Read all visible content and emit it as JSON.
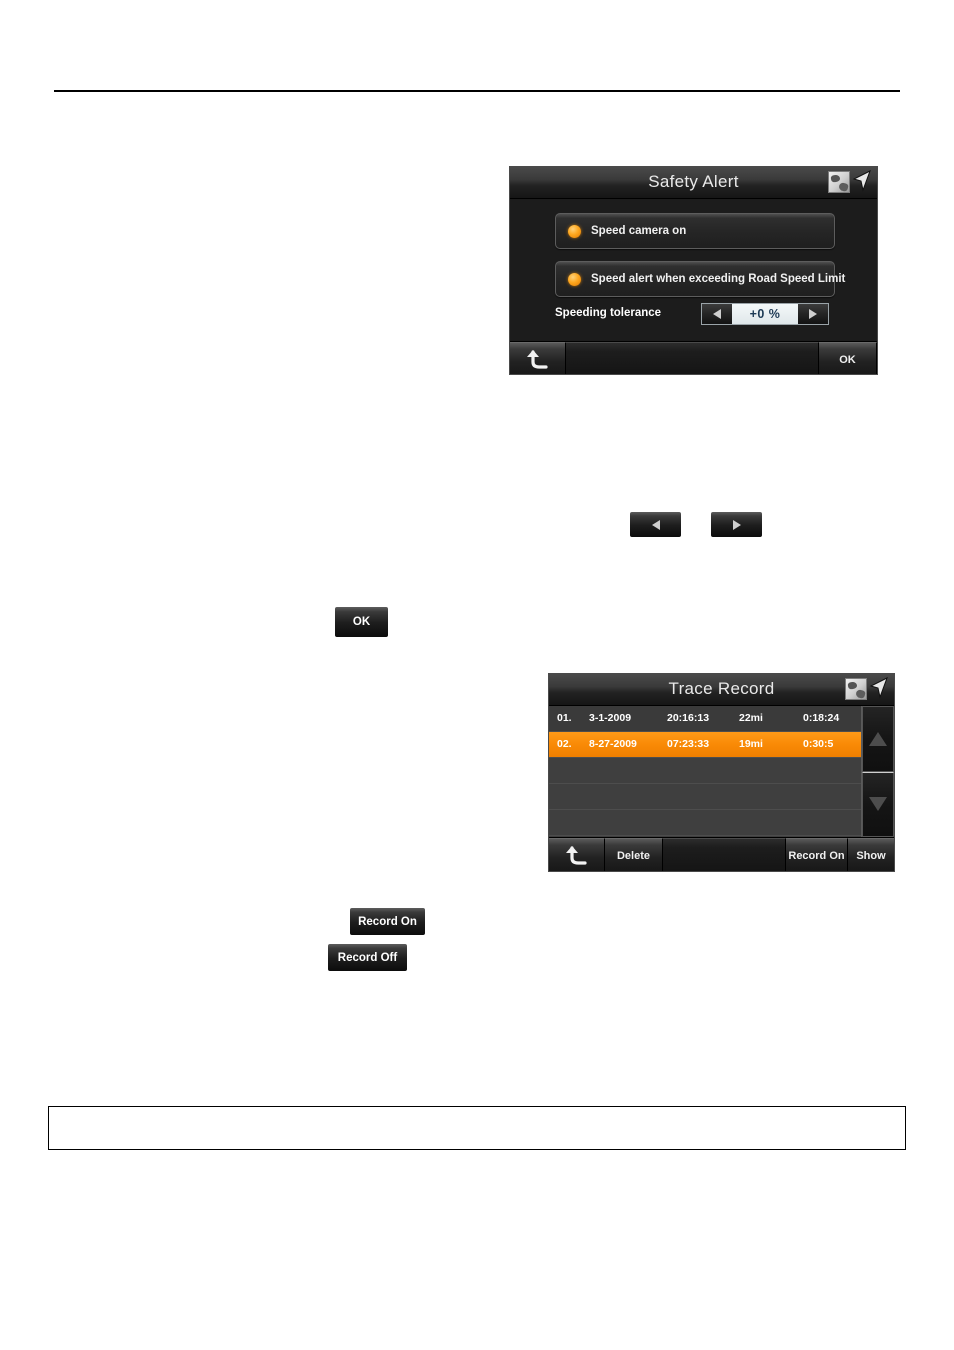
{
  "page": {
    "note_box_text": ""
  },
  "safety_alert": {
    "title": "Safety Alert",
    "corner_icon": "map-cursor-icon",
    "options": [
      {
        "label": "Speed camera on",
        "state_icon": "radio-on-icon"
      },
      {
        "label": "Speed alert when exceeding Road Speed Limit",
        "state_icon": "radio-on-icon"
      }
    ],
    "tolerance": {
      "label": "Speeding tolerance",
      "value": "+0 %",
      "dec_icon": "triangle-left-icon",
      "inc_icon": "triangle-right-icon"
    },
    "toolbar": {
      "back_icon": "back-arrow-icon",
      "ok_label": "OK"
    }
  },
  "trace_record": {
    "title": "Trace Record",
    "corner_icon": "map-cursor-icon",
    "rows": [
      {
        "index": "01.",
        "date": "3-1-2009",
        "time": "20:16:13",
        "distance": "22mi",
        "duration": "0:18:24",
        "selected": false
      },
      {
        "index": "02.",
        "date": "8-27-2009",
        "time": "07:23:33",
        "distance": "19mi",
        "duration": "0:30:5",
        "selected": true
      },
      {
        "index": "",
        "date": "",
        "time": "",
        "distance": "",
        "duration": "",
        "selected": false
      },
      {
        "index": "",
        "date": "",
        "time": "",
        "distance": "",
        "duration": "",
        "selected": false
      },
      {
        "index": "",
        "date": "",
        "time": "",
        "distance": "",
        "duration": "",
        "selected": false
      }
    ],
    "scroll": {
      "up_icon": "triangle-up-icon",
      "down_icon": "triangle-down-icon"
    },
    "toolbar": {
      "back_icon": "back-arrow-icon",
      "delete_label": "Delete",
      "record_on_label": "Record On",
      "show_label": "Show"
    }
  },
  "inline_buttons": {
    "prev": {
      "icon": "triangle-left-icon",
      "label": ""
    },
    "next": {
      "icon": "triangle-right-icon",
      "label": ""
    },
    "ok": {
      "label": "OK"
    },
    "record_on": {
      "label": "Record On"
    },
    "record_off": {
      "label": "Record Off"
    }
  },
  "colors": {
    "accent_orange": "#f98a06",
    "panel_dark": "#1c1c1c",
    "list_bg": "#3f3f3f",
    "text_light": "#ffffff"
  }
}
